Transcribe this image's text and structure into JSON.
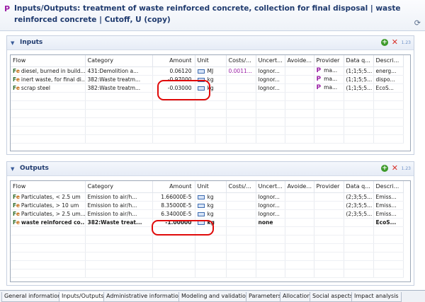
{
  "header": {
    "icon": "P",
    "title": "Inputs/Outputs: treatment of waste reinforced concrete, collection for final disposal | waste reinforced concrete | Cutoff, U (copy)"
  },
  "columns": [
    "Flow",
    "Category",
    "Amount",
    "Unit",
    "Costs/...",
    "Uncert...",
    "Avoide...",
    "Provider",
    "Data q...",
    "Descri..."
  ],
  "inputs": {
    "title": "Inputs",
    "count_badge": "1.23",
    "rows": [
      {
        "flow": "diesel, burned in build...",
        "category": "431:Demolition a...",
        "amount": "0.06120",
        "unit": "MJ",
        "costs": "0.0011...",
        "uncertainty": "lognor...",
        "avoided": "",
        "provider_icon": "P",
        "provider": "ma...",
        "data_quality": "(1;1;5;5...",
        "description": "energ..."
      },
      {
        "flow": "inert waste, for final di...",
        "category": "382:Waste treatm...",
        "amount": "-0.97000",
        "unit": "kg",
        "costs": "",
        "uncertainty": "lognor...",
        "avoided": "",
        "provider_icon": "P",
        "provider": "ma...",
        "data_quality": "(1;1;5;5...",
        "description": "dispo..."
      },
      {
        "flow": "scrap steel",
        "category": "382:Waste treatm...",
        "amount": "-0.03000",
        "unit": "kg",
        "costs": "",
        "uncertainty": "lognor...",
        "avoided": "",
        "provider_icon": "P",
        "provider": "ma...",
        "data_quality": "(1;1;5;5...",
        "description": "EcoS..."
      }
    ]
  },
  "outputs": {
    "title": "Outputs",
    "count_badge": "1.23",
    "rows": [
      {
        "flow": "Particulates, < 2.5 um",
        "category": "Emission to air/h...",
        "amount": "1.66000E-5",
        "unit": "kg",
        "costs": "",
        "uncertainty": "lognor...",
        "avoided": "",
        "provider": "",
        "data_quality": "(2;3;5;5...",
        "description": "Emiss..."
      },
      {
        "flow": "Particulates, > 10 um",
        "category": "Emission to air/h...",
        "amount": "8.35000E-5",
        "unit": "kg",
        "costs": "",
        "uncertainty": "lognor...",
        "avoided": "",
        "provider": "",
        "data_quality": "(2;3;5;5...",
        "description": "Emiss..."
      },
      {
        "flow": "Particulates, > 2.5 um...",
        "category": "Emission to air/h...",
        "amount": "6.34000E-5",
        "unit": "kg",
        "costs": "",
        "uncertainty": "lognor...",
        "avoided": "",
        "provider": "",
        "data_quality": "(2;3;5;5...",
        "description": "Emiss..."
      },
      {
        "flow": "waste reinforced co...",
        "category": "382:Waste treat...",
        "amount": "-1.00000",
        "unit": "kg",
        "costs": "",
        "uncertainty": "none",
        "avoided": "",
        "provider": "",
        "data_quality": "",
        "description": "EcoS..."
      }
    ]
  },
  "tabs": [
    "General information",
    "Inputs/Outputs",
    "Administrative information",
    "Modeling and validation",
    "Parameters",
    "Allocation",
    "Social aspects",
    "Impact analysis"
  ],
  "colors": {
    "accent": "#1f3a6e",
    "highlight": "#e00a0a",
    "provider": "#9b1fa6",
    "add": "#3d9a2a"
  }
}
